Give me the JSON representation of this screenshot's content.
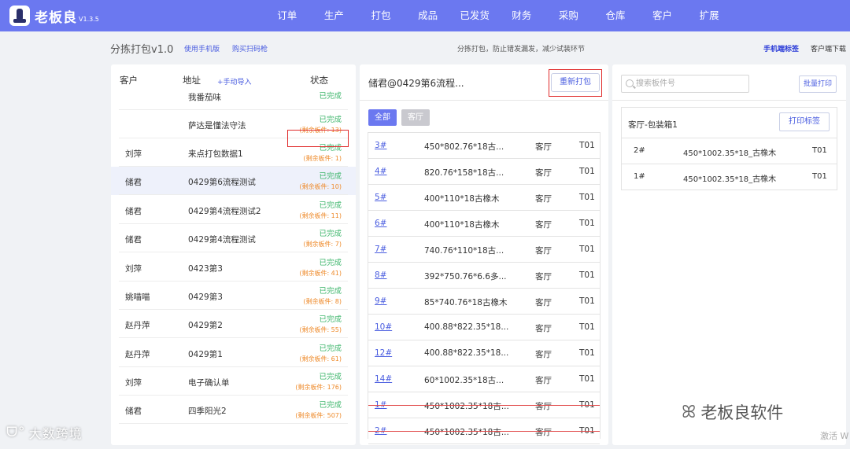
{
  "header": {
    "logo_name": "老板良",
    "logo_version": "V1.3.5",
    "nav": [
      "订单",
      "生产",
      "打包",
      "成品",
      "已发货",
      "财务",
      "采购",
      "仓库",
      "客户",
      "扩展"
    ]
  },
  "subbar": {
    "title": "分拣打包v1.0",
    "link_mobile": "使用手机版",
    "link_scanner": "购买扫码枪",
    "hint": "分拣打包，防止错发漏发，减少试装环节",
    "link_mobile_label": "手机端标签",
    "client_download": "客户端下载"
  },
  "customers": {
    "col_customer": "客户",
    "col_address": "地址",
    "import_label": "+手动导入",
    "col_status": "状态",
    "rows": [
      {
        "customer": "",
        "address": "我番茄味",
        "status": "已完成",
        "remaining": ""
      },
      {
        "customer": "",
        "address": "萨达是懂法守法",
        "status": "已完成",
        "remaining": "(剩余板件: 13)"
      },
      {
        "customer": "刘萍",
        "address": "来点打包数据1",
        "status": "已完成",
        "remaining": "(剩余板件: 1)"
      },
      {
        "customer": "储君",
        "address": "0429第6流程测试",
        "status": "已完成",
        "remaining": "(剩余板件: 10)"
      },
      {
        "customer": "储君",
        "address": "0429第4流程测试2",
        "status": "已完成",
        "remaining": "(剩余板件: 11)"
      },
      {
        "customer": "储君",
        "address": "0429第4流程测试",
        "status": "已完成",
        "remaining": "(剩余板件: 7)"
      },
      {
        "customer": "刘萍",
        "address": "0423第3",
        "status": "已完成",
        "remaining": "(剩余板件: 41)"
      },
      {
        "customer": "姚喵喵",
        "address": "0429第3",
        "status": "已完成",
        "remaining": "(剩余板件: 8)"
      },
      {
        "customer": "赵丹萍",
        "address": "0429第2",
        "status": "已完成",
        "remaining": "(剩余板件: 55)"
      },
      {
        "customer": "赵丹萍",
        "address": "0429第1",
        "status": "已完成",
        "remaining": "(剩余板件: 61)"
      },
      {
        "customer": "刘萍",
        "address": "电子确认单",
        "status": "已完成",
        "remaining": "(剩余板件: 176)"
      },
      {
        "customer": "储君",
        "address": "四季阳光2",
        "status": "已完成",
        "remaining": "(剩余板件: 507)"
      }
    ]
  },
  "packing": {
    "title": "储君@0429第6流程...",
    "repack_label": "重新打包",
    "tab_all": "全部",
    "tab_room": "客厅",
    "rows": [
      {
        "no": "3#",
        "size": "450*802.76*18古...",
        "room": "客厅",
        "type": "T01",
        "packed": false
      },
      {
        "no": "4#",
        "size": "820.76*158*18古...",
        "room": "客厅",
        "type": "T01",
        "packed": false
      },
      {
        "no": "5#",
        "size": "400*110*18古橡木",
        "room": "客厅",
        "type": "T01",
        "packed": false
      },
      {
        "no": "6#",
        "size": "400*110*18古橡木",
        "room": "客厅",
        "type": "T01",
        "packed": false
      },
      {
        "no": "7#",
        "size": "740.76*110*18古...",
        "room": "客厅",
        "type": "T01",
        "packed": false
      },
      {
        "no": "8#",
        "size": "392*750.76*6.6多...",
        "room": "客厅",
        "type": "T01",
        "packed": false
      },
      {
        "no": "9#",
        "size": "85*740.76*18古橡木",
        "room": "客厅",
        "type": "T01",
        "packed": false
      },
      {
        "no": "10#",
        "size": "400.88*822.35*18...",
        "room": "客厅",
        "type": "T01",
        "packed": false
      },
      {
        "no": "12#",
        "size": "400.88*822.35*18...",
        "room": "客厅",
        "type": "T01",
        "packed": false
      },
      {
        "no": "14#",
        "size": "60*1002.35*18古...",
        "room": "客厅",
        "type": "T01",
        "packed": false
      },
      {
        "no": "1#",
        "size": "450*1002.35*18古...",
        "room": "客厅",
        "type": "T01",
        "packed": true
      },
      {
        "no": "2#",
        "size": "450*1002.35*18古...",
        "room": "客厅",
        "type": "T01",
        "packed": true
      }
    ]
  },
  "labels": {
    "search_placeholder": "搜索板件号",
    "batch_print": "批量打印",
    "box_title": "客厅-包装箱1",
    "print_label": "打印标签",
    "rows": [
      {
        "no": "2#",
        "size": "450*1002.35*18_古橡木",
        "type": "T01"
      },
      {
        "no": "1#",
        "size": "450*1002.35*18_古橡木",
        "type": "T01"
      }
    ]
  },
  "watermarks": {
    "left": "大数跨境",
    "right": "老板良软件",
    "activate": "激活 W"
  },
  "colors": {
    "brand": "#6b78f0",
    "done": "#3bb56a",
    "remaining": "#ee8a2a",
    "highlight": "#e02a2a"
  }
}
